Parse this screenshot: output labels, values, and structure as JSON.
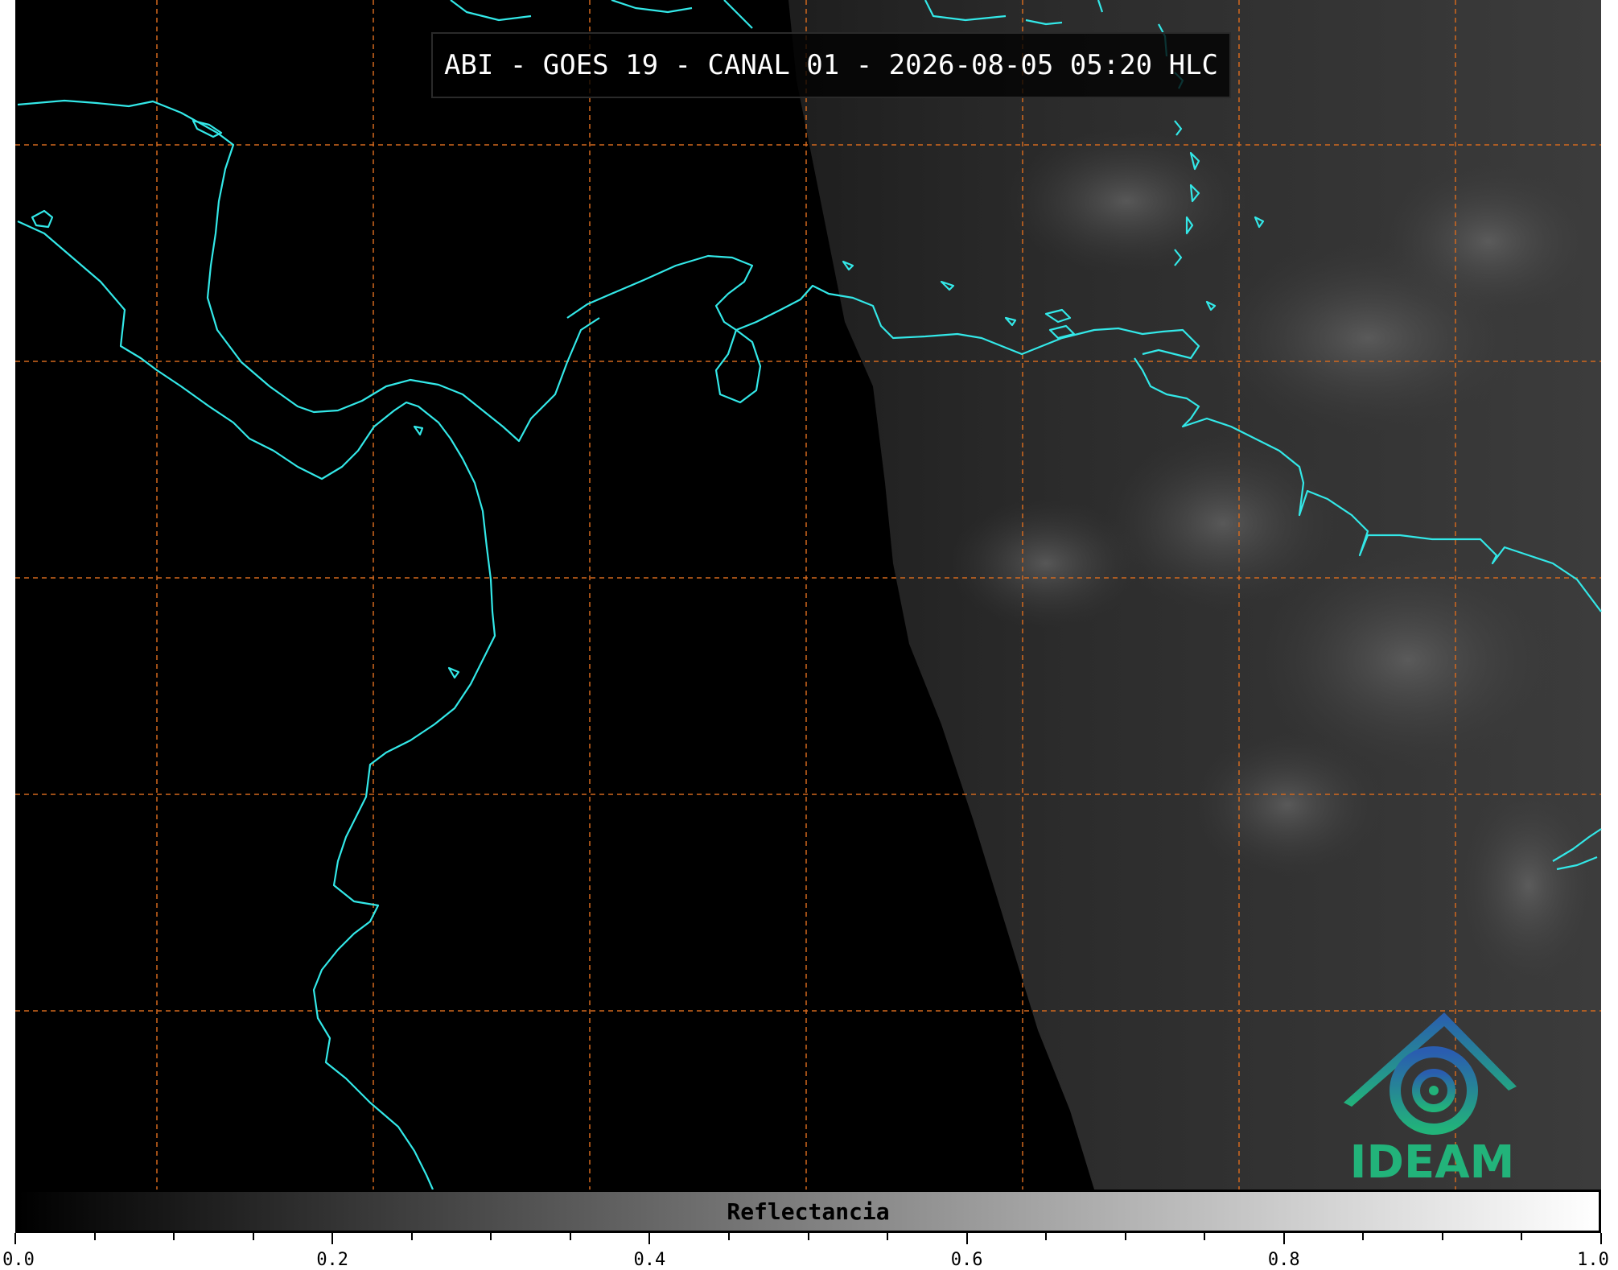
{
  "title": "ABI - GOES 19 - CANAL 01 - 2026-08-05 05:20 HLC",
  "logo_text": "IDEAM",
  "colorbar": {
    "label": "Reflectancia",
    "ticks": [
      "0.0",
      "0.2",
      "0.4",
      "0.6",
      "0.8",
      "1.0"
    ],
    "range": [
      0.0,
      1.0
    ],
    "colormap": "grayscale black-to-white"
  },
  "colors": {
    "coastline": "#33e8e8",
    "graticule": "#d2691e",
    "night_side": "#000000",
    "day_side": "#3a3a3a",
    "logo_gradient": [
      "#2a5db0",
      "#22b37a"
    ]
  },
  "graticule": {
    "style": "dashed",
    "lines": "lat-lon"
  },
  "map": {
    "projection": "satellite imagery",
    "region": "Caribbean / Central America / northern South America"
  }
}
